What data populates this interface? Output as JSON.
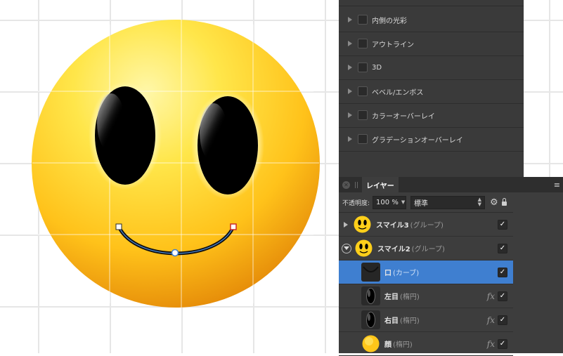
{
  "effects": {
    "items": [
      {
        "label": "内側の光彩"
      },
      {
        "label": "アウトライン"
      },
      {
        "label": "3D"
      },
      {
        "label": "ベベル/エンボス"
      },
      {
        "label": "カラーオーバーレイ"
      },
      {
        "label": "グラデーションオーバーレイ"
      }
    ]
  },
  "layers_panel": {
    "tab_label": "レイヤー",
    "menu_icon": "≡",
    "opacity_label": "不透明度:",
    "opacity_value": "100 %",
    "blend_mode": "標準",
    "layers": [
      {
        "name": "スマイル3",
        "type": "(グループ)",
        "checked": "✓",
        "fx": ""
      },
      {
        "name": "スマイル2",
        "type": "(グループ)",
        "checked": "✓",
        "fx": ""
      },
      {
        "name": "口",
        "type": "(カーブ)",
        "checked": "✓",
        "fx": ""
      },
      {
        "name": "左目",
        "type": "(楕円)",
        "checked": "✓",
        "fx": "fx"
      },
      {
        "name": "右目",
        "type": "(楕円)",
        "checked": "✓",
        "fx": "fx"
      },
      {
        "name": "顔",
        "type": "(楕円)",
        "checked": "✓",
        "fx": "fx"
      }
    ]
  },
  "colors": {
    "selection": "#3f7fd0",
    "panel_bg": "#3d3d3d",
    "face_yellow": "#ffd21f",
    "curve_handle_end": "#cc2a2a"
  }
}
